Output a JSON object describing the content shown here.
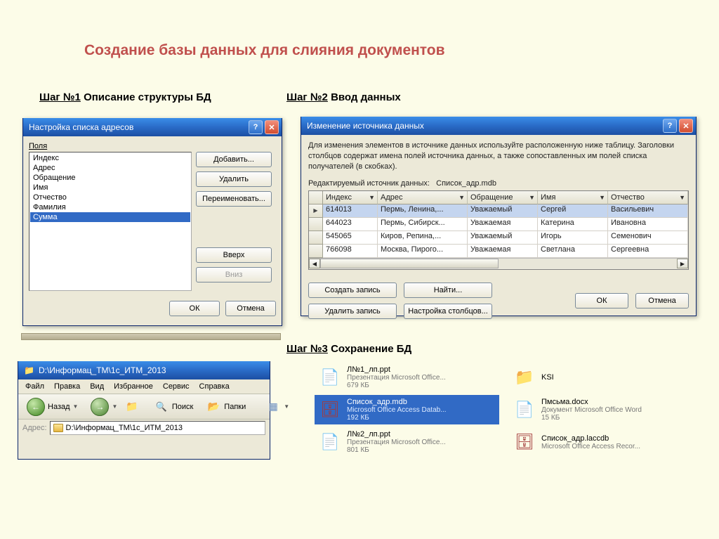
{
  "page": {
    "title": "Создание базы данных для слияния документов",
    "step1_label": "Шаг №1",
    "step1_desc": "Описание структуры БД",
    "step2_label": "Шаг №2",
    "step2_desc": "Ввод данных",
    "step3_label": "Шаг №3",
    "step3_desc": "Сохранение БД"
  },
  "dlg1": {
    "title": "Настройка списка адресов",
    "fields_label": "Поля",
    "items": [
      "Индекс",
      "Адрес",
      "Обращение",
      "Имя",
      "Отчество",
      "Фамилия",
      "Сумма"
    ],
    "selected_index": 6,
    "btn_add": "Добавить...",
    "btn_delete": "Удалить",
    "btn_rename": "Переименовать...",
    "btn_up": "Вверх",
    "btn_down": "Вниз",
    "btn_ok": "ОК",
    "btn_cancel": "Отмена"
  },
  "dlg2": {
    "title": "Изменение источника данных",
    "description": "Для изменения элементов в источнике данных используйте расположенную ниже таблицу. Заголовки столбцов содержат имена полей источника данных, а также сопоставленных им полей списка получателей (в скобках).",
    "edit_src_label": "Редактируемый источник данных:",
    "edit_src_value": "Список_адр.mdb",
    "columns": [
      "Индекс",
      "Адрес",
      "Обращение",
      "Имя",
      "Отчество"
    ],
    "rows": [
      {
        "selected": true,
        "cells": [
          "614013",
          "Пермь, Ленина,...",
          "Уважаемый",
          "Сергей",
          "Васильевич"
        ]
      },
      {
        "selected": false,
        "cells": [
          "644023",
          "Пермь, Сибирск...",
          "Уважаемая",
          "Катерина",
          "Ивановна"
        ]
      },
      {
        "selected": false,
        "cells": [
          "545065",
          "Киров, Репина,...",
          "Уважаемый",
          "Игорь",
          "Семенович"
        ]
      },
      {
        "selected": false,
        "cells": [
          "766098",
          "Москва, Пирого...",
          "Уважаемая",
          "Светлана",
          "Сергеевна"
        ]
      }
    ],
    "btn_new": "Создать запись",
    "btn_find": "Найти...",
    "btn_delete": "Удалить запись",
    "btn_columns": "Настройка столбцов...",
    "btn_ok": "ОК",
    "btn_cancel": "Отмена"
  },
  "explorer": {
    "title": "D:\\Информац_ТМ\\1с_ИТМ_2013",
    "menu": [
      "Файл",
      "Правка",
      "Вид",
      "Избранное",
      "Сервис",
      "Справка"
    ],
    "back": "Назад",
    "search": "Поиск",
    "folders": "Папки",
    "address_label": "Адрес:",
    "address_value": "D:\\Информац_ТМ\\1с_ИТМ_2013"
  },
  "files": [
    {
      "name": "Л№1_лп.ppt",
      "sub1": "Презентация Microsoft Office...",
      "sub2": "679 КБ",
      "icon": "ppt",
      "selected": false
    },
    {
      "name": "KSI",
      "sub1": "",
      "sub2": "",
      "icon": "folder",
      "selected": false
    },
    {
      "name": "Список_адр.mdb",
      "sub1": "Microsoft Office Access Datab...",
      "sub2": "192 КБ",
      "icon": "mdb",
      "selected": true
    },
    {
      "name": "Пмсьма.docx",
      "sub1": "Документ Microsoft Office Word",
      "sub2": "15 КБ",
      "icon": "docx",
      "selected": false
    },
    {
      "name": "Л№2_лп.ppt",
      "sub1": "Презентация Microsoft Office...",
      "sub2": "801 КБ",
      "icon": "ppt",
      "selected": false
    },
    {
      "name": "Список_адр.laccdb",
      "sub1": "Microsoft Office Access Recor...",
      "sub2": "",
      "icon": "access",
      "selected": false
    }
  ]
}
